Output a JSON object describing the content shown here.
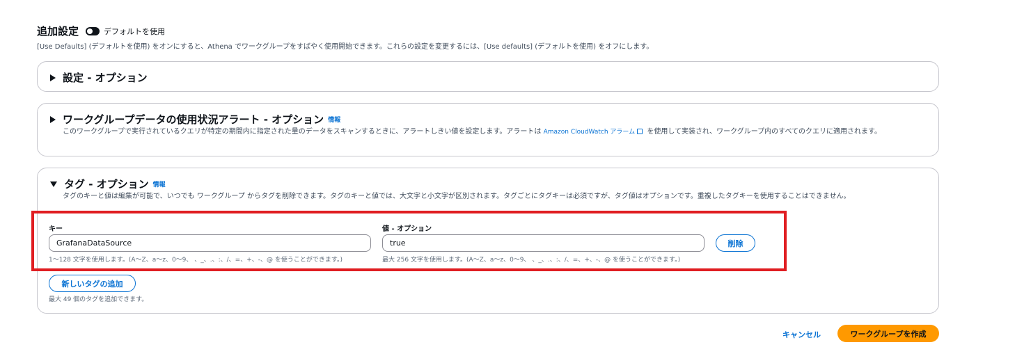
{
  "section": {
    "title": "追加設定",
    "toggle_label": "デフォルトを使用",
    "description": "[Use Defaults] (デフォルトを使用) をオンにすると、Athena でワークグループをすばやく使用開始できます。これらの設定を変更するには、[Use defaults] (デフォルトを使用) をオフにします。"
  },
  "panels": {
    "settings": {
      "title": "設定 - オプション"
    },
    "alerts": {
      "title": "ワークグループデータの使用状況アラート - オプション",
      "info": "情報",
      "desc_before": "このワークグループで実行されているクエリが特定の期間内に指定された量のデータをスキャンするときに、アラートしきい値を設定します。アラートは",
      "link": "Amazon CloudWatch アラーム",
      "desc_after": "を使用して実装され、ワークグループ内のすべてのクエリに適用されます。"
    },
    "tags": {
      "title": "タグ - オプション",
      "info": "情報",
      "description": "タグのキーと値は編集が可能で、いつでも ワークグループ からタグを削除できます。タグのキーと値では、大文字と小文字が区別されます。タグごとにタグキーは必須ですが、タグ値はオプションです。重複したタグキーを使用することはできません。",
      "key_label": "キー",
      "value_label": "値 - オプション",
      "key_value": "GrafanaDataSource",
      "value_value": "true",
      "key_hint": "1〜128 文字を使用します。(A〜Z、a〜z、0〜9、 、_、.、:、/、=、+、-、@ を使うことができます。)",
      "value_hint": "最大 256 文字を使用します。(A〜Z、a〜z、0〜9、 、_、.、:、/、=、+、-、@ を使うことができます。)",
      "remove_button": "削除",
      "add_button": "新しいタグの追加",
      "limit_hint": "最大 49 個のタグを追加できます。"
    }
  },
  "footer": {
    "cancel": "キャンセル",
    "create": "ワークグループを作成"
  },
  "colors": {
    "accent": "#0972d3",
    "primary_button": "#ff9900",
    "highlight_box": "#e01e22"
  }
}
